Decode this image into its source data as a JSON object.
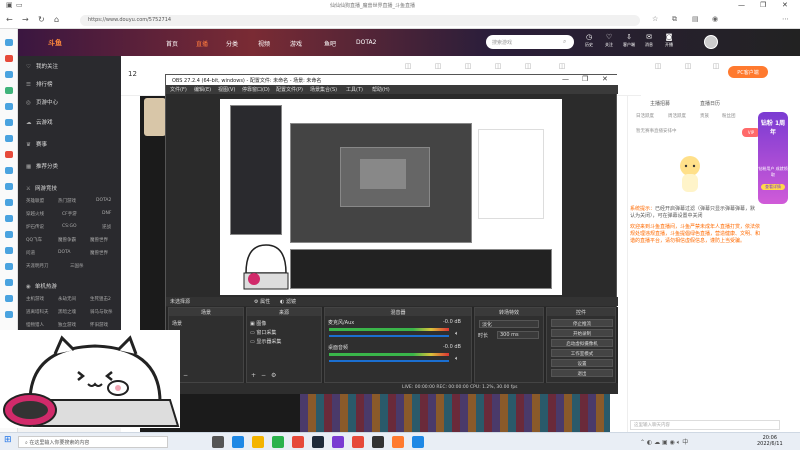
{
  "browser": {
    "window_title": "仙仙仙狗直播_魔兽世界直播_斗鱼直播",
    "url": "https://www.douyu.com/5752714",
    "win_controls": [
      "—",
      "❐",
      "✕"
    ]
  },
  "douyu": {
    "logo": "斗鱼",
    "nav": [
      "首页",
      "直播",
      "分类",
      "视频",
      "游戏",
      "鱼吧",
      "DOTA2"
    ],
    "search_placeholder": "搜索游戏",
    "top_icons": [
      "历史",
      "关注",
      "客户端",
      "消息",
      "开播"
    ],
    "sidebar_items": [
      "我的关注",
      "排行榜",
      "页游中心",
      "云游戏",
      "赛事",
      "推荐分类"
    ],
    "sidebar_section": "网游竞技",
    "sidebar_grid": [
      "英雄联盟",
      "热门游戏",
      "DOTA2",
      "穿越火线",
      "CF手游",
      "DNF",
      "炉石传说",
      "CS:GO",
      "逆战",
      "QQ飞车",
      "魔兽争霸",
      "魔兽世界",
      "问道",
      "DOTA",
      "魔兽世界",
      "天涯明月刀",
      "三国杀"
    ],
    "sidebar_section2": "单机热游",
    "sidebar_grid2": [
      "主机游戏",
      "永劫无间",
      "生死狙击2",
      "逃离塔科夫",
      "黑暗之魂",
      "骑马与砍杀",
      "怪物猎人",
      "独立游戏",
      "怀旧游戏"
    ],
    "viewer_count": "12",
    "pc_button": "PC客户端"
  },
  "right_panel": {
    "tabs": [
      "主播招募",
      "直播日历"
    ],
    "sub_tabs": [
      "日活跃度",
      "周活跃度",
      "贵族",
      "粉丝团"
    ],
    "subtitle": "暂无赛事直播安排中",
    "badge_title": "钻粉 1周年",
    "badge_sub": "钻粉用户 成就领取",
    "badge_btn": "查看详情",
    "vip": "VIP",
    "chat": [
      {
        "label": "系统提示：",
        "text": "已经开启弹幕过滤（弹幕只显示弹幕弹幕，默认为关闭），可在弹幕设置中关闭"
      },
      {
        "label": "",
        "text": "欢迎来到斗鱼直播间，斗鱼严禁未成年人直播打赏，依法依规处理违规直播，斗鱼提倡绿色直播，营造健康、文明、和谐的直播平台，请勿相信虚假信息，谨防上当受骗。"
      }
    ],
    "chat_input": "这里输入聊天内容"
  },
  "obs": {
    "title": "OBS 27.2.4 (64-bit, windows) - 配置文件: 未命名 - 场景: 未命名",
    "menu": [
      "文件(F)",
      "编辑(E)",
      "视图(V)",
      "停靠窗口(D)",
      "配置文件(P)",
      "场景集合(S)",
      "工具(T)",
      "帮助(H)"
    ],
    "source_bar_label": "未选择源",
    "source_bar_buttons": [
      "属性",
      "滤镜"
    ],
    "docks": {
      "scenes": {
        "header": "场景",
        "items": [
          "场景"
        ]
      },
      "sources": {
        "header": "来源",
        "items": [
          "图像",
          "窗口采集",
          "显示器采集"
        ]
      },
      "mixer": {
        "header": "混音器",
        "tracks": [
          {
            "name": "麦克风/Aux",
            "level": "-0.0 dB"
          },
          {
            "name": "桌面音频",
            "level": "-0.0 dB"
          }
        ]
      },
      "transitions": {
        "header": "转场特效",
        "type": "淡化",
        "duration_label": "时长",
        "duration": "300 ms"
      },
      "controls": {
        "header": "控件",
        "buttons": [
          "停止推流",
          "开始录制",
          "启动虚拟摄像机",
          "工作室模式",
          "设置",
          "退出"
        ]
      }
    },
    "status": "LIVE: 00:00:00   REC: 00:00:00   CPU: 1.2%, 30.00 fps"
  },
  "taskbar": {
    "search_placeholder": "在这里输入你要搜索的内容",
    "time": "20:06",
    "date": "2022/6/11"
  }
}
